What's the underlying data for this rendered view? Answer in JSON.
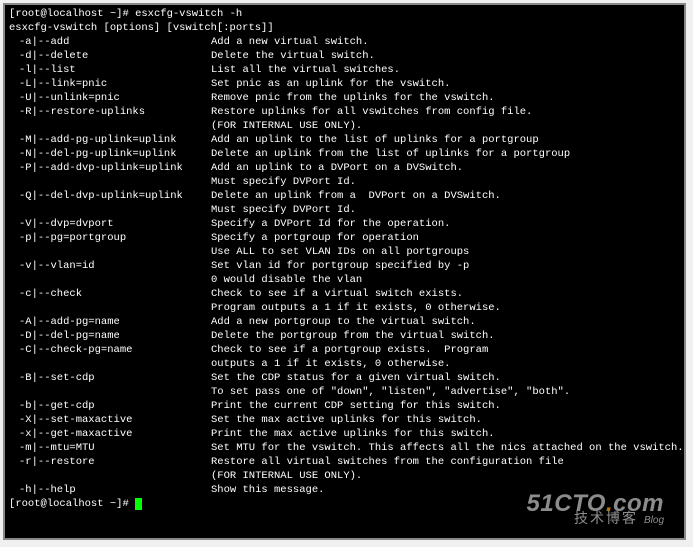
{
  "prompt1": {
    "user": "root@localhost",
    "path": "~",
    "command": "esxcfg-vswitch -h"
  },
  "usage": "esxcfg-vswitch [options] [vswitch[:ports]]",
  "options": [
    {
      "opt": "-a|--add",
      "desc": "Add a new virtual switch."
    },
    {
      "opt": "-d|--delete",
      "desc": "Delete the virtual switch."
    },
    {
      "opt": "-l|--list",
      "desc": "List all the virtual switches."
    },
    {
      "opt": "-L|--link=pnic",
      "desc": "Set pnic as an uplink for the vswitch."
    },
    {
      "opt": "-U|--unlink=pnic",
      "desc": "Remove pnic from the uplinks for the vswitch."
    },
    {
      "opt": "-R|--restore-uplinks",
      "desc": "Restore uplinks for all vswitches from config file."
    },
    {
      "opt": "",
      "desc": "(FOR INTERNAL USE ONLY)."
    },
    {
      "opt": "-M|--add-pg-uplink=uplink",
      "desc": "Add an uplink to the list of uplinks for a portgroup"
    },
    {
      "opt": "-N|--del-pg-uplink=uplink",
      "desc": "Delete an uplink from the list of uplinks for a portgroup"
    },
    {
      "opt": "-P|--add-dvp-uplink=uplink",
      "desc": "Add an uplink to a DVPort on a DVSwitch."
    },
    {
      "opt": "",
      "desc": "Must specify DVPort Id."
    },
    {
      "opt": "-Q|--del-dvp-uplink=uplink",
      "desc": "Delete an uplink from a  DVPort on a DVSwitch."
    },
    {
      "opt": "",
      "desc": "Must specify DVPort Id."
    },
    {
      "opt": "-V|--dvp=dvport",
      "desc": "Specify a DVPort Id for the operation."
    },
    {
      "opt": "-p|--pg=portgroup",
      "desc": "Specify a portgroup for operation"
    },
    {
      "opt": "",
      "desc": "Use ALL to set VLAN IDs on all portgroups"
    },
    {
      "opt": "-v|--vlan=id",
      "desc": "Set vlan id for portgroup specified by -p"
    },
    {
      "opt": "",
      "desc": "0 would disable the vlan"
    },
    {
      "opt": "-c|--check",
      "desc": "Check to see if a virtual switch exists."
    },
    {
      "opt": "",
      "desc": "Program outputs a 1 if it exists, 0 otherwise."
    },
    {
      "opt": "-A|--add-pg=name",
      "desc": "Add a new portgroup to the virtual switch."
    },
    {
      "opt": "-D|--del-pg=name",
      "desc": "Delete the portgroup from the virtual switch."
    },
    {
      "opt": "-C|--check-pg=name",
      "desc": "Check to see if a portgroup exists.  Program"
    },
    {
      "opt": "",
      "desc": "outputs a 1 if it exists, 0 otherwise."
    },
    {
      "opt": "-B|--set-cdp",
      "desc": "Set the CDP status for a given virtual switch."
    },
    {
      "opt": "",
      "desc": "To set pass one of \"down\", \"listen\", \"advertise\", \"both\"."
    },
    {
      "opt": "-b|--get-cdp",
      "desc": "Print the current CDP setting for this switch."
    },
    {
      "opt": "-X|--set-maxactive",
      "desc": "Set the max active uplinks for this switch."
    },
    {
      "opt": "-x|--get-maxactive",
      "desc": "Print the max active uplinks for this switch."
    },
    {
      "opt": "-m|--mtu=MTU",
      "desc": "Set MTU for the vswitch. This affects all the nics attached on the vswitch."
    },
    {
      "opt": "-r|--restore",
      "desc": "Restore all virtual switches from the configuration file"
    },
    {
      "opt": "",
      "desc": "(FOR INTERNAL USE ONLY)."
    },
    {
      "opt": "-h|--help",
      "desc": "Show this message."
    }
  ],
  "prompt2": {
    "user": "root@localhost",
    "path": "~"
  },
  "watermark": {
    "main": "51CTO",
    "dot": ".",
    "com": "com",
    "sub": "技术博客",
    "blog": "Blog"
  }
}
